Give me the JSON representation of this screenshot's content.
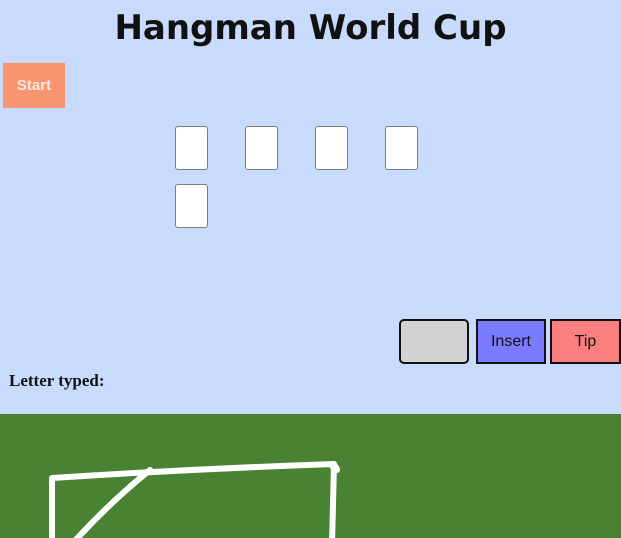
{
  "title": "Hangman World Cup",
  "start_label": "Start",
  "word_slots": [
    "",
    "",
    "",
    "",
    ""
  ],
  "letter_input": {
    "value": "",
    "placeholder": ""
  },
  "insert_label": "Insert",
  "tip_label": "Tip",
  "letter_typed_label": "Letter typed:",
  "letters_typed": "",
  "colors": {
    "background": "#c8dbfc",
    "start": "#f89470",
    "insert": "#7b7bff",
    "tip": "#fb7f7f",
    "field": "#4a8233",
    "goal_lines": "#ffffff"
  },
  "scene": {
    "field_icon": "soccer-field",
    "goal_icon": "goal-frame"
  }
}
